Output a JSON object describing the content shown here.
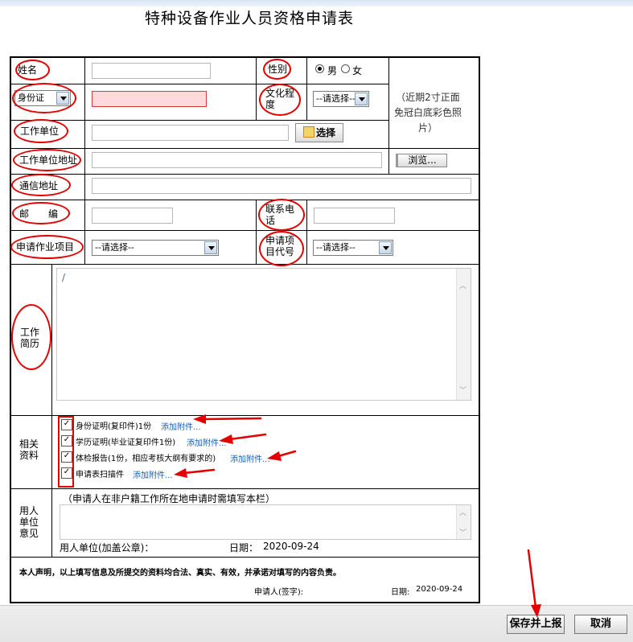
{
  "page": {
    "title": "特种设备作业人员资格申请表"
  },
  "labels": {
    "name": "姓名",
    "gender": "性别",
    "id_type": "身份证",
    "education": "文化程度",
    "workplace": "工作单位",
    "workplace_addr": "工作单位地址",
    "mail_addr": "通信地址",
    "postcode": "邮　　编",
    "phone": "联系电话",
    "project": "申请作业项目",
    "project_code": "申请项目代号",
    "resume": "工作简历",
    "materials": "相关资料",
    "employer_opinion": "用人单位意见"
  },
  "gender_options": {
    "male": "男",
    "female": "女",
    "selected": "男"
  },
  "select_placeholder": "--请选择--",
  "photo_note": "（近期2寸正面免冠白底彩色照片）",
  "buttons": {
    "choose": "选择",
    "browse": "浏览...",
    "save": "保存并上报",
    "cancel": "取消"
  },
  "resume_text": "/",
  "materials": [
    {
      "text": "身份证明(复印件)1份",
      "link": "添加附件...",
      "checked": true
    },
    {
      "text": "学历证明(毕业证复印件1份)",
      "link": "添加附件...",
      "checked": true
    },
    {
      "text": "体检报告(1份，相应考核大纲有要求的)",
      "link": "添加附件...",
      "checked": true
    },
    {
      "text": "申请表扫描件",
      "link": "添加附件...",
      "checked": true
    }
  ],
  "employer": {
    "note": "（申请人在非户籍工作所在地申请时需填写本栏）",
    "seal_label": "用人单位(加盖公章)：",
    "date_label": "日期：",
    "date": "2020-09-24"
  },
  "declaration": {
    "text": "本人声明，以上填写信息及所提交的资料均合法、真实、有效，并承诺对填写的内容负责。",
    "signer_label": "申请人(签字):",
    "date_label": "日期:",
    "date": "2020-09-24"
  },
  "colors": {
    "annotation": "#e30000",
    "link": "#1a5fb4",
    "error_bg": "#ffd9dc"
  }
}
